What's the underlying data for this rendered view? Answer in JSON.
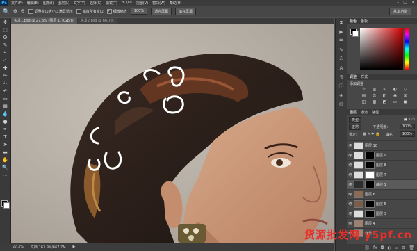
{
  "app": {
    "logo": "Ps"
  },
  "menubar": {
    "items": [
      "文件(F)",
      "编辑(E)",
      "图像(I)",
      "图层(L)",
      "文字(Y)",
      "选择(S)",
      "滤镜(T)",
      "3D(D)",
      "视图(V)",
      "窗口(W)",
      "帮助(H)"
    ]
  },
  "options": {
    "zoom_tool": "Q",
    "resize_windows_label": "调整窗口大小以满屏显示",
    "zoom_all_label": "缩放所有窗口",
    "scrubby_zoom_label": "细微缩放",
    "actual_pixels_button": "100%",
    "fit_screen_button": "适合屏幕",
    "fill_screen_button": "填充屏幕",
    "workspace": "基本功能"
  },
  "document": {
    "tab1": "头发1.psd @ 27.3% (图层 1, RGB/8)",
    "tab2": "头发2.psd @ 66.7%",
    "zoom": "27.3%",
    "doc_size": "文档:163.9M/667.7M"
  },
  "panels": {
    "color_tab": "颜色",
    "swatches_tab": "色板",
    "adjust_tab": "调整",
    "styles_tab": "样式",
    "adjust_label": "添加调整",
    "layers_tab": "图层",
    "channels_tab": "通道",
    "paths_tab": "路径",
    "kind_label": "类型",
    "blend_mode": "正常",
    "opacity_label": "不透明度:",
    "opacity_value": "100%",
    "lock_label": "锁定:",
    "fill_label": "填充:",
    "fill_value": "100%"
  },
  "layers": [
    {
      "name": "图层 10"
    },
    {
      "name": "图层 9"
    },
    {
      "name": "图层 8"
    },
    {
      "name": "图层 7"
    },
    {
      "name": "曲线 1"
    },
    {
      "name": "图层 6"
    },
    {
      "name": "图层 5"
    },
    {
      "name": "图层 3"
    },
    {
      "name": "图层 4"
    },
    {
      "name": "背景"
    }
  ],
  "watermark": "货源批发网 y5pf.cn"
}
